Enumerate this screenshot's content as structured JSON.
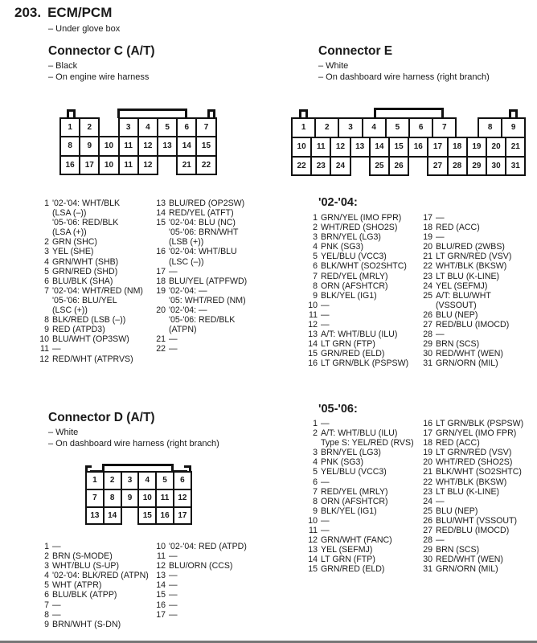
{
  "header": {
    "number": "203.",
    "title": "ECM/PCM",
    "location": "– Under glove box"
  },
  "connector_c": {
    "title": "Connector C (A/T)",
    "notes": [
      "– Black",
      "– On engine wire harness"
    ],
    "cells": [
      "1",
      "2",
      "3",
      "4",
      "5",
      "6",
      "7",
      "8",
      "9",
      "10",
      "11",
      "12",
      "13",
      "14",
      "15",
      "16",
      "17",
      "10",
      "11",
      "12",
      "21",
      "22"
    ],
    "pins_col1": [
      {
        "n": "1",
        "lines": [
          "'02-'04: WHT/BLK",
          "(LSA (–))",
          "'05-'06: RED/BLK",
          "(LSA (+))"
        ]
      },
      {
        "n": "2",
        "lines": [
          "GRN (SHC)"
        ]
      },
      {
        "n": "3",
        "lines": [
          "YEL (SHE)"
        ]
      },
      {
        "n": "4",
        "lines": [
          "GRN/WHT (SHB)"
        ]
      },
      {
        "n": "5",
        "lines": [
          "GRN/RED (SHD)"
        ]
      },
      {
        "n": "6",
        "lines": [
          "BLU/BLK (SHA)"
        ]
      },
      {
        "n": "7",
        "lines": [
          "'02-'04: WHT/RED (NM)",
          "'05-'06: BLU/YEL",
          "(LSC (+))"
        ]
      },
      {
        "n": "8",
        "lines": [
          "BLK/RED (LSB (–))"
        ]
      },
      {
        "n": "9",
        "lines": [
          "RED (ATPD3)"
        ]
      },
      {
        "n": "10",
        "lines": [
          "BLU/WHT (OP3SW)"
        ]
      },
      {
        "n": "11",
        "lines": [
          "—"
        ]
      },
      {
        "n": "12",
        "lines": [
          "RED/WHT (ATPRVS)"
        ]
      }
    ],
    "pins_col2": [
      {
        "n": "13",
        "lines": [
          "BLU/RED (OP2SW)"
        ]
      },
      {
        "n": "14",
        "lines": [
          "RED/YEL (ATFT)"
        ]
      },
      {
        "n": "15",
        "lines": [
          "'02-'04: BLU (NC)",
          "'05-'06: BRN/WHT",
          "(LSB (+))"
        ]
      },
      {
        "n": "16",
        "lines": [
          "'02-'04: WHT/BLU",
          "(LSC (–))"
        ]
      },
      {
        "n": "17",
        "lines": [
          "—"
        ]
      },
      {
        "n": "18",
        "lines": [
          "BLU/YEL (ATPFWD)"
        ]
      },
      {
        "n": "19",
        "lines": [
          "'02-'04: —",
          "'05: WHT/RED (NM)"
        ]
      },
      {
        "n": "20",
        "lines": [
          "'02-'04: —",
          "'05-'06: RED/BLK",
          "(ATPN)"
        ]
      },
      {
        "n": "21",
        "lines": [
          "—"
        ]
      },
      {
        "n": "22",
        "lines": [
          "—"
        ]
      }
    ]
  },
  "connector_e": {
    "title": "Connector E",
    "notes": [
      "– White",
      "– On dashboard wire harness (right branch)"
    ],
    "cells_row1": [
      "1",
      "2",
      "3",
      "4",
      "5",
      "6",
      "7",
      "8",
      "9"
    ],
    "cells_row2": [
      "10",
      "11",
      "12",
      "13",
      "14",
      "15",
      "16",
      "17",
      "18",
      "19",
      "20",
      "21"
    ],
    "cells_row3": [
      "22",
      "23",
      "24",
      "25",
      "26",
      "27",
      "28",
      "29",
      "30",
      "31"
    ],
    "years_0204": {
      "title": "'02-'04:",
      "pins_col1": [
        {
          "n": "1",
          "lines": [
            "GRN/YEL (IMO FPR)"
          ]
        },
        {
          "n": "2",
          "lines": [
            "WHT/RED (SHO2S)"
          ]
        },
        {
          "n": "3",
          "lines": [
            "BRN/YEL (LG3)"
          ]
        },
        {
          "n": "4",
          "lines": [
            "PNK (SG3)"
          ]
        },
        {
          "n": "5",
          "lines": [
            "YEL/BLU (VCC3)"
          ]
        },
        {
          "n": "6",
          "lines": [
            "BLK/WHT (SO2SHTC)"
          ]
        },
        {
          "n": "7",
          "lines": [
            "RED/YEL (MRLY)"
          ]
        },
        {
          "n": "8",
          "lines": [
            "ORN (AFSHTCR)"
          ]
        },
        {
          "n": "9",
          "lines": [
            "BLK/YEL (IG1)"
          ]
        },
        {
          "n": "10",
          "lines": [
            "—"
          ]
        },
        {
          "n": "11",
          "lines": [
            "—"
          ]
        },
        {
          "n": "12",
          "lines": [
            "—"
          ]
        },
        {
          "n": "13",
          "lines": [
            "A/T: WHT/BLU (ILU)"
          ]
        },
        {
          "n": "14",
          "lines": [
            "LT GRN (FTP)"
          ]
        },
        {
          "n": "15",
          "lines": [
            "GRN/RED (ELD)"
          ]
        },
        {
          "n": "16",
          "lines": [
            "LT GRN/BLK (PSPSW)"
          ]
        }
      ],
      "pins_col2": [
        {
          "n": "17",
          "lines": [
            "—"
          ]
        },
        {
          "n": "18",
          "lines": [
            "RED (ACC)"
          ]
        },
        {
          "n": "19",
          "lines": [
            "—"
          ]
        },
        {
          "n": "20",
          "lines": [
            "BLU/RED (2WBS)"
          ]
        },
        {
          "n": "21",
          "lines": [
            "LT GRN/RED (VSV)"
          ]
        },
        {
          "n": "22",
          "lines": [
            "WHT/BLK (BKSW)"
          ]
        },
        {
          "n": "23",
          "lines": [
            "LT BLU (K-LINE)"
          ]
        },
        {
          "n": "24",
          "lines": [
            "YEL (SEFMJ)"
          ]
        },
        {
          "n": "25",
          "lines": [
            "A/T: BLU/WHT",
            "(VSSOUT)"
          ]
        },
        {
          "n": "26",
          "lines": [
            "BLU (NEP)"
          ]
        },
        {
          "n": "27",
          "lines": [
            "RED/BLU (IMOCD)"
          ]
        },
        {
          "n": "28",
          "lines": [
            "—"
          ]
        },
        {
          "n": "29",
          "lines": [
            "BRN (SCS)"
          ]
        },
        {
          "n": "30",
          "lines": [
            "RED/WHT (WEN)"
          ]
        },
        {
          "n": "31",
          "lines": [
            "GRN/ORN (MIL)"
          ]
        }
      ]
    },
    "years_0506": {
      "title": "'05-'06:",
      "pins_col1": [
        {
          "n": "1",
          "lines": [
            "—"
          ]
        },
        {
          "n": "2",
          "lines": [
            "A/T: WHT/BLU (ILU)",
            "Type S: YEL/RED (RVS)"
          ]
        },
        {
          "n": "3",
          "lines": [
            "BRN/YEL (LG3)"
          ]
        },
        {
          "n": "4",
          "lines": [
            "PNK (SG3)"
          ]
        },
        {
          "n": "5",
          "lines": [
            "YEL/BLU (VCC3)"
          ]
        },
        {
          "n": "6",
          "lines": [
            "—"
          ]
        },
        {
          "n": "7",
          "lines": [
            "RED/YEL (MRLY)"
          ]
        },
        {
          "n": "8",
          "lines": [
            "ORN (AFSHTCR)"
          ]
        },
        {
          "n": "9",
          "lines": [
            "BLK/YEL (IG1)"
          ]
        },
        {
          "n": "10",
          "lines": [
            "—"
          ]
        },
        {
          "n": "11",
          "lines": [
            "—"
          ]
        },
        {
          "n": "12",
          "lines": [
            "GRN/WHT (FANC)"
          ]
        },
        {
          "n": "13",
          "lines": [
            "YEL (SEFMJ)"
          ]
        },
        {
          "n": "14",
          "lines": [
            "LT GRN (FTP)"
          ]
        },
        {
          "n": "15",
          "lines": [
            "GRN/RED (ELD)"
          ]
        }
      ],
      "pins_col2": [
        {
          "n": "16",
          "lines": [
            "LT GRN/BLK (PSPSW)"
          ]
        },
        {
          "n": "17",
          "lines": [
            "GRN/YEL (IMO FPR)"
          ]
        },
        {
          "n": "18",
          "lines": [
            "RED (ACC)"
          ]
        },
        {
          "n": "19",
          "lines": [
            "LT GRN/RED (VSV)"
          ]
        },
        {
          "n": "20",
          "lines": [
            "WHT/RED (SHO2S)"
          ]
        },
        {
          "n": "21",
          "lines": [
            "BLK/WHT (SO2SHTC)"
          ]
        },
        {
          "n": "22",
          "lines": [
            "WHT/BLK (BKSW)"
          ]
        },
        {
          "n": "23",
          "lines": [
            "LT BLU (K-LINE)"
          ]
        },
        {
          "n": "24",
          "lines": [
            "—"
          ]
        },
        {
          "n": "25",
          "lines": [
            "BLU (NEP)"
          ]
        },
        {
          "n": "26",
          "lines": [
            "BLU/WHT (VSSOUT)"
          ]
        },
        {
          "n": "27",
          "lines": [
            "RED/BLU (IMOCD)"
          ]
        },
        {
          "n": "28",
          "lines": [
            "—"
          ]
        },
        {
          "n": "29",
          "lines": [
            "BRN (SCS)"
          ]
        },
        {
          "n": "30",
          "lines": [
            "RED/WHT (WEN)"
          ]
        },
        {
          "n": "31",
          "lines": [
            "GRN/ORN (MIL)"
          ]
        }
      ]
    }
  },
  "connector_d": {
    "title": "Connector D (A/T)",
    "notes": [
      "– White",
      "– On dashboard wire harness (right branch)"
    ],
    "cells": [
      "1",
      "2",
      "3",
      "4",
      "5",
      "6",
      "7",
      "8",
      "9",
      "10",
      "11",
      "12",
      "13",
      "14",
      "15",
      "16",
      "17"
    ],
    "pins_col1": [
      {
        "n": "1",
        "lines": [
          "—"
        ]
      },
      {
        "n": "2",
        "lines": [
          "BRN (S-MODE)"
        ]
      },
      {
        "n": "3",
        "lines": [
          "WHT/BLU (S-UP)"
        ]
      },
      {
        "n": "4",
        "lines": [
          "'02-'04: BLK/RED (ATPN)"
        ]
      },
      {
        "n": "5",
        "lines": [
          "WHT (ATPR)"
        ]
      },
      {
        "n": "6",
        "lines": [
          "BLU/BLK (ATPP)"
        ]
      },
      {
        "n": "7",
        "lines": [
          "—"
        ]
      },
      {
        "n": "8",
        "lines": [
          "—"
        ]
      },
      {
        "n": "9",
        "lines": [
          "BRN/WHT (S-DN)"
        ]
      }
    ],
    "pins_col2": [
      {
        "n": "10",
        "lines": [
          "'02-'04: RED (ATPD)"
        ]
      },
      {
        "n": "11",
        "lines": [
          "—"
        ]
      },
      {
        "n": "12",
        "lines": [
          "BLU/ORN (CCS)"
        ]
      },
      {
        "n": "13",
        "lines": [
          "—"
        ]
      },
      {
        "n": "14",
        "lines": [
          "—"
        ]
      },
      {
        "n": "15",
        "lines": [
          "—"
        ]
      },
      {
        "n": "16",
        "lines": [
          "—"
        ]
      },
      {
        "n": "17",
        "lines": [
          "—"
        ]
      }
    ]
  }
}
